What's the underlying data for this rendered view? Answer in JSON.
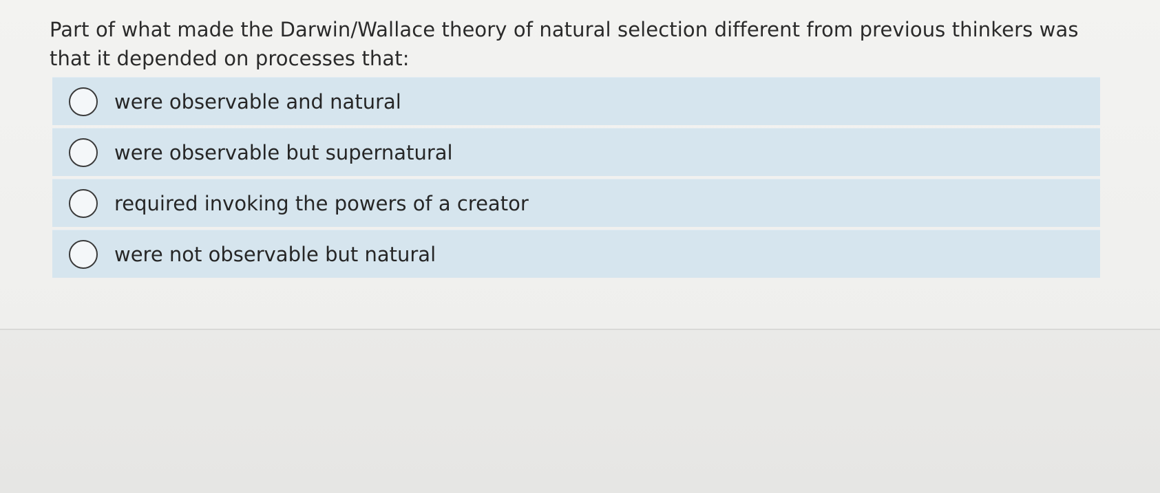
{
  "question": {
    "text": "Part of what made the Darwin/Wallace theory of natural selection different from previous thinkers was that it depended on processes that:"
  },
  "options": [
    {
      "label": "were observable and natural",
      "selected": false
    },
    {
      "label": "were observable but supernatural",
      "selected": false
    },
    {
      "label": "required invoking the powers of a creator",
      "selected": false
    },
    {
      "label": "were not observable but natural",
      "selected": false
    }
  ],
  "colors": {
    "option_background": "#d6e5ee",
    "page_background": "#efefed"
  }
}
